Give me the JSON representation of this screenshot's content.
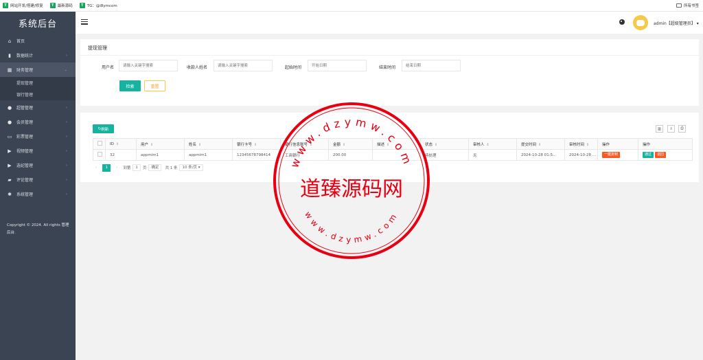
{
  "bookmarks": [
    {
      "label": "网站开发/搭建/修复"
    },
    {
      "label": "最新源码"
    },
    {
      "label": "TG：@i8ymcom"
    }
  ],
  "bookmarks_right": "所有书签",
  "sidebar": {
    "brand": "系统后台",
    "items": [
      {
        "label": "首页",
        "icon": "home-icon",
        "has_arrow": false
      },
      {
        "label": "数据统计",
        "icon": "chart-icon",
        "has_arrow": true
      },
      {
        "label": "财务管理",
        "icon": "bank-icon",
        "has_arrow": true,
        "active": true
      },
      {
        "label": "超管管理",
        "icon": "user-icon",
        "has_arrow": true
      },
      {
        "label": "会员管理",
        "icon": "users-icon",
        "has_arrow": true
      },
      {
        "label": "彩票管理",
        "icon": "gamepad-icon",
        "has_arrow": true
      },
      {
        "label": "视频管理",
        "icon": "video-icon",
        "has_arrow": true
      },
      {
        "label": "选妃管理",
        "icon": "video-icon",
        "has_arrow": true
      },
      {
        "label": "评论管理",
        "icon": "comment-icon",
        "has_arrow": true
      },
      {
        "label": "系统管理",
        "icon": "gear-icon",
        "has_arrow": true
      }
    ],
    "subitems": [
      "提现管理",
      "银行管理"
    ],
    "copyright": "Copyright © 2024. All rights 管理后台."
  },
  "header": {
    "user": "admin【超级管理员】",
    "dropdown": "▾"
  },
  "search": {
    "title": "提现管理",
    "fields": [
      {
        "label": "用户名",
        "placeholder": "请输入关键字搜索"
      },
      {
        "label": "收款人姓名",
        "placeholder": "请输入关键字搜索"
      },
      {
        "label": "起始时间",
        "placeholder": "开始日期"
      },
      {
        "label": "结束时间",
        "placeholder": "结束日期"
      }
    ],
    "search_label": "检索",
    "reset_label": "重置"
  },
  "table": {
    "refresh_label": "刷新",
    "columns": [
      "ID",
      "用户",
      "姓名",
      "银行卡号",
      "银行信息账号",
      "金额",
      "描述",
      "状态",
      "审核人",
      "提交时间",
      "审核时间",
      "操作",
      "操作"
    ],
    "rows": [
      {
        "id": "32",
        "user": "appmim1",
        "name": "appmim1",
        "card": "12345678798414",
        "bank": "工商银行",
        "amount": "200.00",
        "desc": "",
        "status": "待处理",
        "reviewer": "无",
        "submit_time": "2024-10-28 01:5...",
        "review_time": "2024-10-28 01:5...",
        "op1": "一键复制",
        "op2_pass": "通过",
        "op2_reject": "退回"
      }
    ],
    "pager": {
      "current": "1",
      "goto_label": "到第",
      "goto_value": "1",
      "page_unit": "页",
      "confirm": "确定",
      "total": "共 1 条",
      "per_page": "10 条/页"
    }
  },
  "watermark": {
    "center": "道臻源码网",
    "ring_top": "www.dzymw.com",
    "ring_bottom": "www.dzymw.com"
  },
  "colors": {
    "sidebar_bg": "#3b4453",
    "accent": "#16b4a0",
    "warn": "#ff5722",
    "stamp": "#e60012"
  }
}
